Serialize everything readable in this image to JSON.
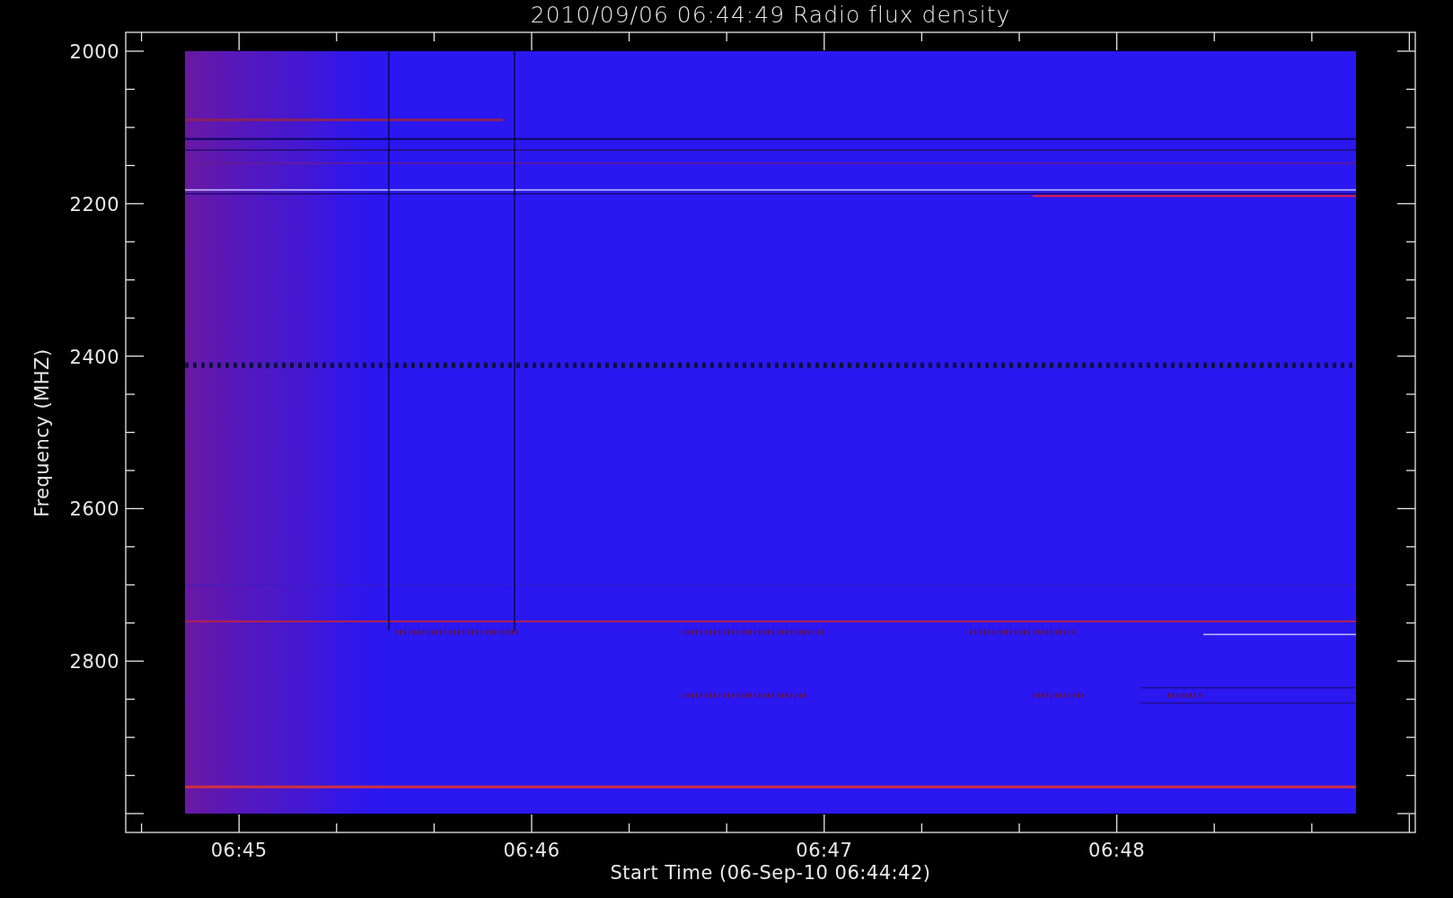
{
  "title": "2010/09/06 06:44:49 Radio flux density",
  "y_axis": {
    "label": "Frequency (MHZ)",
    "ticks": [
      "2000",
      "2200",
      "2400",
      "2600",
      "2800"
    ]
  },
  "x_axis": {
    "label": "Start Time (06-Sep-10 06:44:42)",
    "ticks": [
      "06:45",
      "06:46",
      "06:47",
      "06:48"
    ]
  }
}
